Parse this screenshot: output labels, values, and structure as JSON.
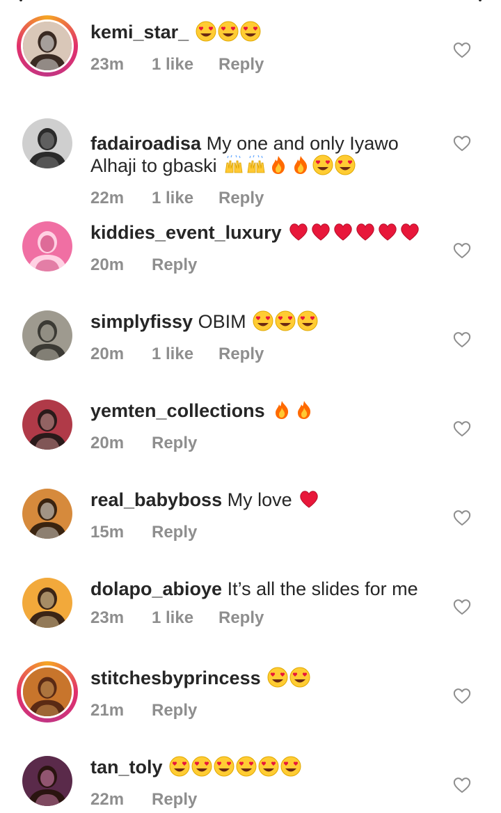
{
  "comments": [
    {
      "username": "kemi_star_",
      "text": "",
      "emojis": [
        "heart-eyes",
        "heart-eyes",
        "heart-eyes"
      ],
      "time": "23m",
      "likes": "1 like",
      "reply": "Reply",
      "story_ring": true,
      "avatar_colors": [
        "#d9c7b8",
        "#3a2a22",
        "#ffffff"
      ]
    },
    {
      "username": "fadairoadisa",
      "text": "My one and only Iyawo",
      "text2": "Alhaji to gbaski",
      "emojis": [
        "raised-hands",
        "raised-hands",
        "fire",
        "fire",
        "heart-eyes",
        "heart-eyes"
      ],
      "time": "22m",
      "likes": "1 like",
      "reply": "Reply",
      "story_ring": false,
      "avatar_colors": [
        "#cfcfcf",
        "#2b2b2b",
        "#8a8a8a"
      ]
    },
    {
      "username": "kiddies_event_luxury",
      "text": "",
      "emojis": [
        "red-heart",
        "red-heart",
        "red-heart",
        "red-heart",
        "red-heart",
        "red-heart"
      ],
      "time": "20m",
      "likes": "",
      "reply": "Reply",
      "story_ring": false,
      "avatar_colors": [
        "#f06fa3",
        "#ffd1e3",
        "#c2185b"
      ]
    },
    {
      "username": "simplyfissy",
      "text": "OBIM",
      "emojis": [
        "heart-eyes",
        "heart-eyes",
        "heart-eyes"
      ],
      "time": "20m",
      "likes": "1 like",
      "reply": "Reply",
      "story_ring": false,
      "avatar_colors": [
        "#9e9a8f",
        "#3b3a34",
        "#d9d4c5"
      ]
    },
    {
      "username": "yemten_collections",
      "text": "",
      "emojis": [
        "fire",
        "fire"
      ],
      "time": "20m",
      "likes": "",
      "reply": "Reply",
      "story_ring": false,
      "avatar_colors": [
        "#b03a48",
        "#2a1a1a",
        "#e8a0a0"
      ]
    },
    {
      "username": "real_babyboss",
      "text": "My love",
      "emojis": [
        "red-heart"
      ],
      "time": "15m",
      "likes": "",
      "reply": "Reply",
      "story_ring": false,
      "avatar_colors": [
        "#d68a3c",
        "#3a2410",
        "#f5f0e6"
      ]
    },
    {
      "username": "dolapo_abioye",
      "text": "It’s all the slides for me",
      "emojis": [],
      "time": "23m",
      "likes": "1 like",
      "reply": "Reply",
      "story_ring": false,
      "avatar_colors": [
        "#f2a93b",
        "#3b2516",
        "#ffe2a8"
      ]
    },
    {
      "username": "stitchesbyprincess",
      "text": "",
      "emojis": [
        "heart-eyes",
        "heart-eyes"
      ],
      "time": "21m",
      "likes": "",
      "reply": "Reply",
      "story_ring": true,
      "avatar_colors": [
        "#c8752c",
        "#5a2a14",
        "#f0b060"
      ]
    },
    {
      "username": "tan_toly",
      "text": "",
      "emojis": [
        "heart-eyes",
        "heart-eyes",
        "heart-eyes",
        "heart-eyes",
        "heart-eyes",
        "heart-eyes"
      ],
      "time": "22m",
      "likes": "",
      "reply": "Reply",
      "story_ring": false,
      "avatar_colors": [
        "#5a2a4a",
        "#2a1410",
        "#e58ac0"
      ]
    }
  ]
}
